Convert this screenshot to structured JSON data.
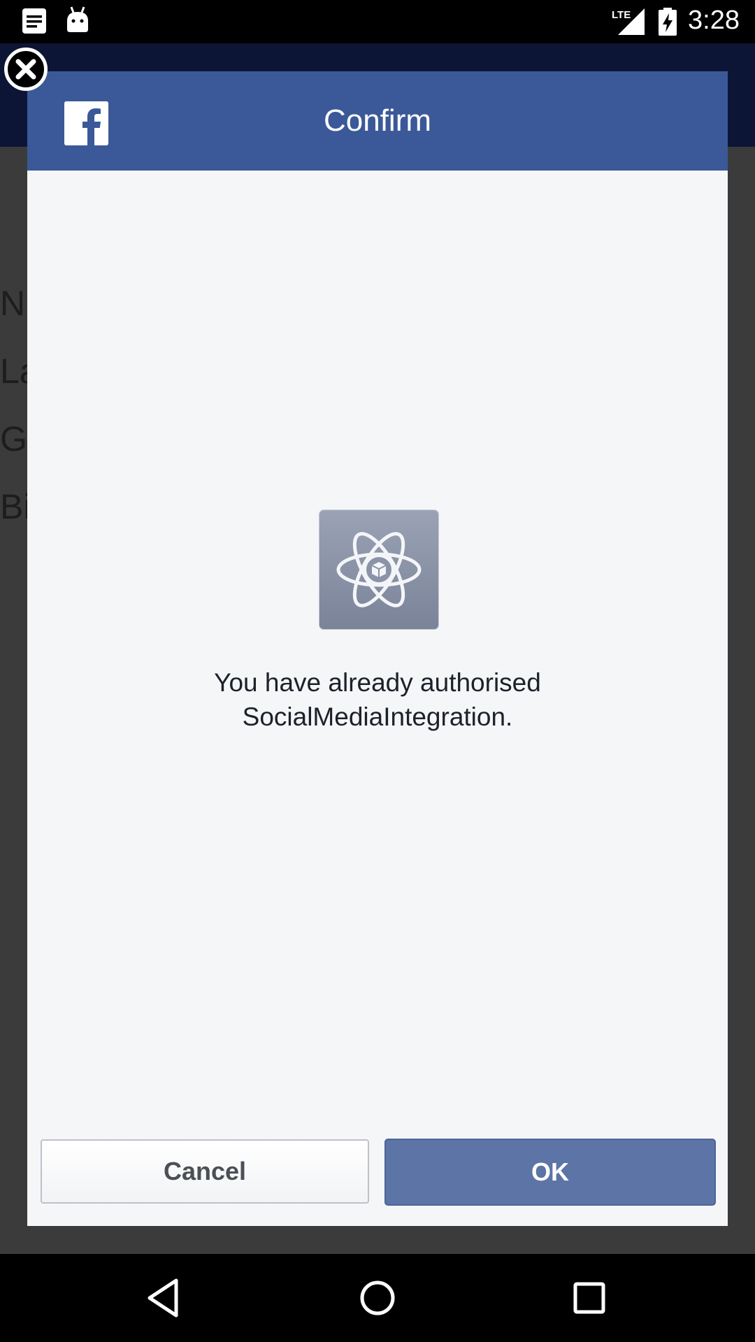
{
  "status_bar": {
    "time": "3:28",
    "network": "LTE",
    "notification_icons": [
      "notes-icon",
      "android-icon"
    ],
    "system_icons": [
      "lte-signal-icon",
      "battery-charging-icon"
    ]
  },
  "background_app": {
    "header_color": "#0d1536",
    "visible_row_fragments": [
      "N",
      "La",
      "G",
      "Bi"
    ]
  },
  "dialog": {
    "title": "Confirm",
    "header_color": "#3b5998",
    "logo": "facebook-logo-icon",
    "app_icon": "atom-app-icon",
    "message_lines": [
      "You have already authorised",
      "SocialMediaIntegration."
    ],
    "cancel_label": "Cancel",
    "ok_label": "OK",
    "ok_color": "#5d74a6"
  },
  "nav_bar": {
    "buttons": [
      "back-icon",
      "home-icon",
      "recents-icon"
    ]
  }
}
